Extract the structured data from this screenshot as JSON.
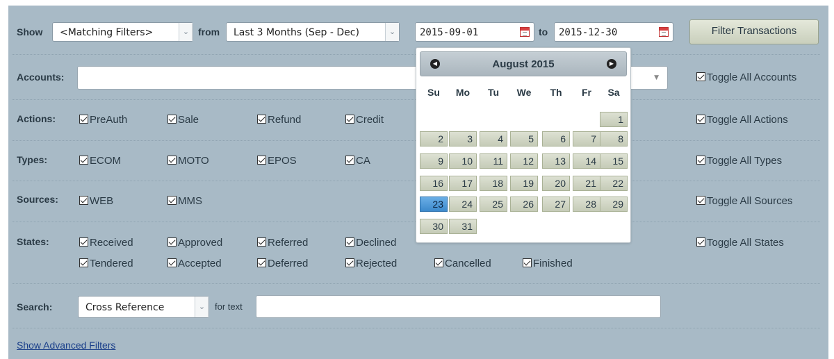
{
  "filters": {
    "show_label": "Show",
    "show_select": "<Matching Filters>",
    "from_label": "from",
    "range_select": "Last 3 Months (Sep - Dec)",
    "date_from": "2015-09-01",
    "to_label": "to",
    "date_to": "2015-12-30",
    "filter_button": "Filter Transactions"
  },
  "rows": {
    "accounts": {
      "label": "Accounts:",
      "toggle": "Toggle All Accounts"
    },
    "actions": {
      "label": "Actions:",
      "items": [
        "PreAuth",
        "Sale",
        "Refund",
        "Credit"
      ],
      "toggle": "Toggle All Actions"
    },
    "types": {
      "label": "Types:",
      "items": [
        "ECOM",
        "MOTO",
        "EPOS",
        "CA"
      ],
      "toggle": "Toggle All Types"
    },
    "sources": {
      "label": "Sources:",
      "items": [
        "WEB",
        "MMS"
      ],
      "toggle": "Toggle All Sources"
    },
    "states": {
      "label": "States:",
      "row1": [
        "Received",
        "Approved",
        "Referred",
        "Declined"
      ],
      "row2": [
        "Tendered",
        "Accepted",
        "Deferred",
        "Rejected",
        "Cancelled",
        "Finished"
      ],
      "toggle": "Toggle All States"
    },
    "search": {
      "label": "Search:",
      "select": "Cross Reference",
      "for_text": "for text"
    }
  },
  "advanced_link": "Show Advanced Filters",
  "calendar": {
    "title": "August 2015",
    "weekdays": [
      "Su",
      "Mo",
      "Tu",
      "We",
      "Th",
      "Fr",
      "Sa"
    ],
    "weeks": [
      [
        "",
        "",
        "",
        "",
        "",
        "",
        "1"
      ],
      [
        "2",
        "3",
        "4",
        "5",
        "6",
        "7",
        "8"
      ],
      [
        "9",
        "10",
        "11",
        "12",
        "13",
        "14",
        "15"
      ],
      [
        "16",
        "17",
        "18",
        "19",
        "20",
        "21",
        "22"
      ],
      [
        "23",
        "24",
        "25",
        "26",
        "27",
        "28",
        "29"
      ],
      [
        "30",
        "31",
        "",
        "",
        "",
        "",
        ""
      ]
    ],
    "selected_day": "23"
  }
}
